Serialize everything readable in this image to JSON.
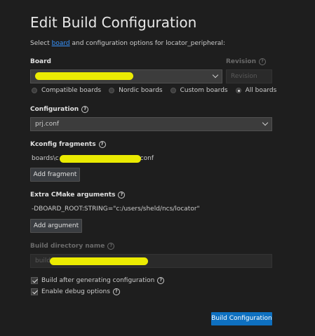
{
  "title": "Edit Build Configuration",
  "subtitle": {
    "prefix": "Select ",
    "link": "board",
    "suffix": " and configuration options for locator_peripheral:"
  },
  "board": {
    "label": "Board",
    "value": ""
  },
  "revision": {
    "label": "Revision",
    "placeholder": "Revision"
  },
  "board_filter": {
    "options": [
      "Compatible boards",
      "Nordic boards",
      "Custom boards",
      "All boards"
    ],
    "selected": "All boards"
  },
  "configuration": {
    "label": "Configuration",
    "value": "prj.conf"
  },
  "kconfig": {
    "label": "Kconfig fragments",
    "path_prefix": "boards\\c",
    "path_suffix": "conf",
    "add_button": "Add fragment"
  },
  "cmake": {
    "label": "Extra CMake arguments",
    "value": "-DBOARD_ROOT:STRING=\"c:/users/sheld/ncs/locator\"",
    "add_button": "Add argument"
  },
  "build_dir": {
    "label": "Build directory name",
    "value": "build"
  },
  "options": {
    "build_after": {
      "label": "Build after generating configuration",
      "checked": true
    },
    "debug": {
      "label": "Enable debug options",
      "checked": true
    }
  },
  "submit": "Build Configuration",
  "colors": {
    "background": "#1e1e1e",
    "primary_button": "#0e70c0",
    "link": "#3794ff",
    "redaction": "#f5f500"
  }
}
